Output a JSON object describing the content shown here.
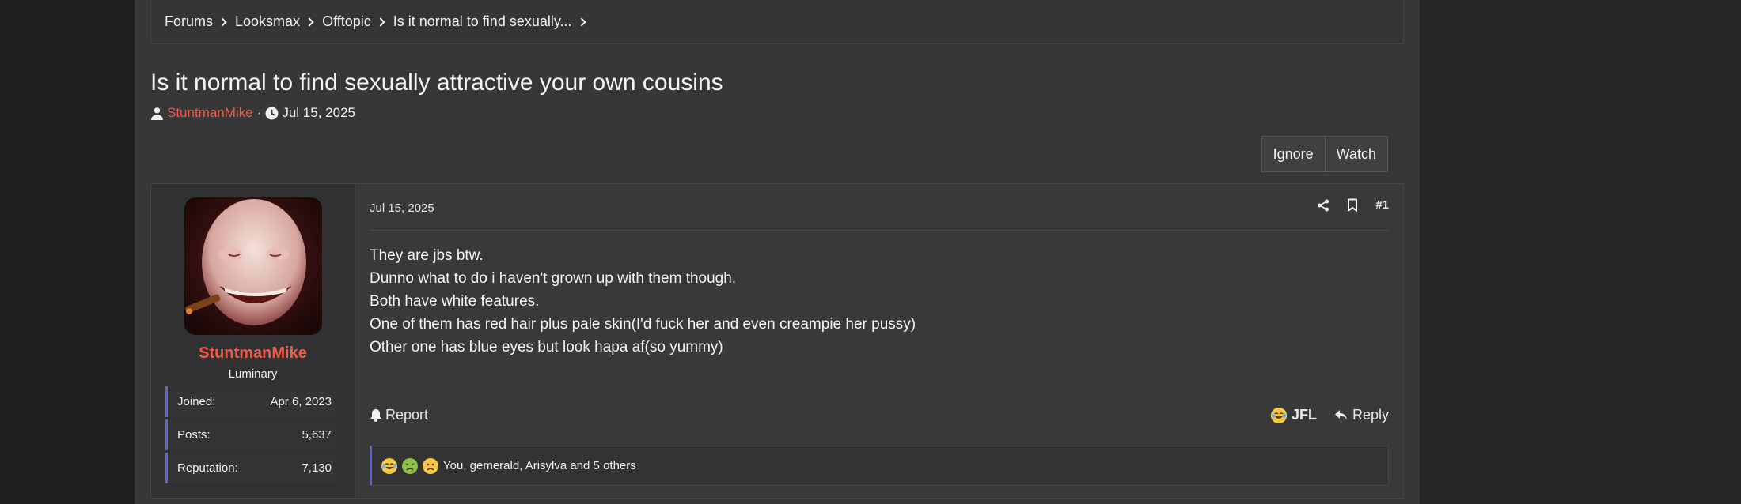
{
  "breadcrumb": [
    "Forums",
    "Looksmax",
    "Offtopic",
    "Is it normal to find sexually..."
  ],
  "thread": {
    "title": "Is it normal to find sexually attractive your own cousins",
    "author": "StuntmanMike",
    "separator": "·",
    "date": "Jul 15, 2025"
  },
  "buttons": {
    "ignore": "Ignore",
    "watch": "Watch"
  },
  "post": {
    "user": {
      "name": "StuntmanMike",
      "title": "Luminary",
      "stats": [
        {
          "label": "Joined:",
          "value": "Apr 6, 2023"
        },
        {
          "label": "Posts:",
          "value": "5,637"
        },
        {
          "label": "Reputation:",
          "value": "7,130"
        }
      ]
    },
    "date": "Jul 15, 2025",
    "number": "#1",
    "lines": [
      "They are jbs btw.",
      "Dunno what to do i haven't grown up with them though.",
      "Both have white features.",
      "One of them has red hair plus pale skin(I'd fuck her and even creampie her pussy)",
      "Other one has blue eyes but look hapa af(so yummy)"
    ],
    "report": "Report",
    "react": "JFL",
    "reply": "Reply",
    "reactions_text": "You, gemerald, Arisylva and 5 others"
  },
  "colors": {
    "accent_red": "#f05a4a",
    "stat_border": "#5a66d6"
  }
}
